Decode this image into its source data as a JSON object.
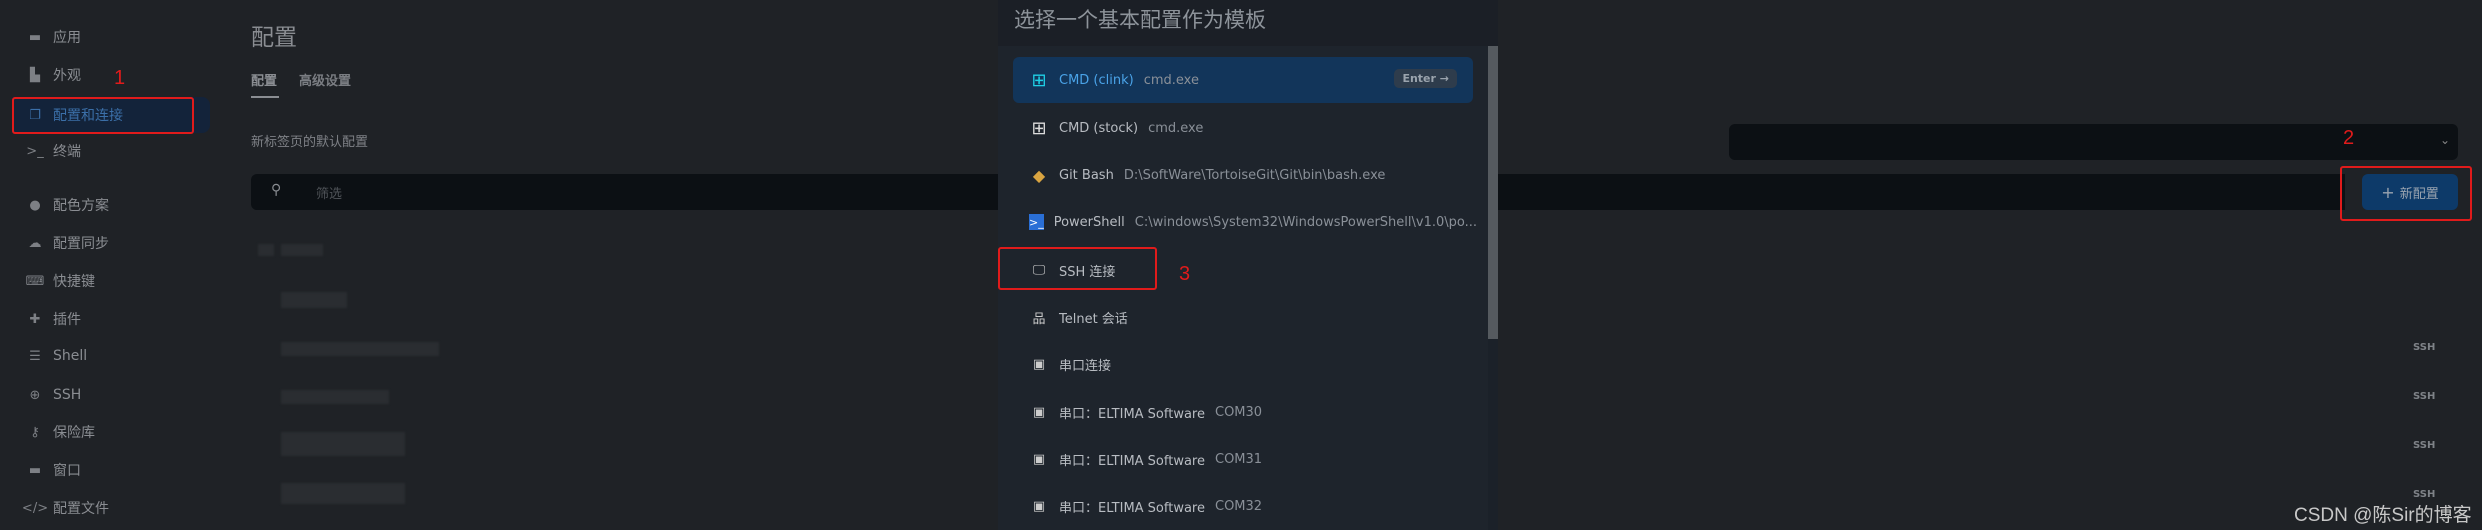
{
  "sidebar": {
    "items": [
      {
        "label": "应用",
        "icon": "app-window-icon"
      },
      {
        "label": "外观",
        "icon": "paint-icon"
      },
      {
        "label": "配置和连接",
        "icon": "profiles-icon",
        "active": true
      },
      {
        "label": "终端",
        "icon": "terminal-icon"
      },
      {
        "label": "配色方案",
        "icon": "palette-icon"
      },
      {
        "label": "配置同步",
        "icon": "cloud-icon"
      },
      {
        "label": "快捷键",
        "icon": "keyboard-icon"
      },
      {
        "label": "插件",
        "icon": "puzzle-icon"
      },
      {
        "label": "Shell",
        "icon": "list-icon"
      },
      {
        "label": "SSH",
        "icon": "globe-icon"
      },
      {
        "label": "保险库",
        "icon": "key-icon"
      },
      {
        "label": "窗口",
        "icon": "window-icon"
      },
      {
        "label": "配置文件",
        "icon": "code-icon"
      }
    ]
  },
  "main": {
    "title": "配置",
    "tabs": [
      {
        "label": "配置",
        "active": true
      },
      {
        "label": "高级设置"
      }
    ],
    "default_profile_label": "新标签页的默认配置",
    "default_profile_value": "",
    "filter_placeholder": "筛选",
    "new_profile_button": "新配置",
    "badges": [
      "SSH",
      "SSH",
      "SSH",
      "SSH"
    ]
  },
  "modal": {
    "title": "选择一个基本配置作为模板",
    "enter_hint": "Enter →",
    "items": [
      {
        "label": "CMD (clink)",
        "detail": "cmd.exe",
        "icon": "windows-icon",
        "selected": true
      },
      {
        "label": "CMD (stock)",
        "detail": "cmd.exe",
        "icon": "windows-icon"
      },
      {
        "label": "Git Bash",
        "detail": "D:\\SoftWare\\TortoiseGit\\Git\\bin\\bash.exe",
        "icon": "git-icon"
      },
      {
        "label": "PowerShell",
        "detail": "C:\\windows\\System32\\WindowsPowerShell\\v1.0\\po...",
        "icon": "powershell-icon"
      },
      {
        "label": "SSH 连接",
        "detail": "",
        "icon": "monitor-icon"
      },
      {
        "label": "Telnet 会话",
        "detail": "",
        "icon": "network-icon"
      },
      {
        "label": "串口连接",
        "detail": "",
        "icon": "chip-icon"
      },
      {
        "label": "串口：ELTIMA Software",
        "detail": "COM30",
        "icon": "chip-icon"
      },
      {
        "label": "串口：ELTIMA Software",
        "detail": "COM31",
        "icon": "chip-icon"
      },
      {
        "label": "串口：ELTIMA Software",
        "detail": "COM32",
        "icon": "chip-icon"
      }
    ]
  },
  "annotations": [
    "1",
    "2",
    "3"
  ],
  "watermark": "CSDN @陈Sir的博客",
  "colors": {
    "accent": "#12355a",
    "annotation": "#e01b1b",
    "button": "#0d3a69"
  }
}
